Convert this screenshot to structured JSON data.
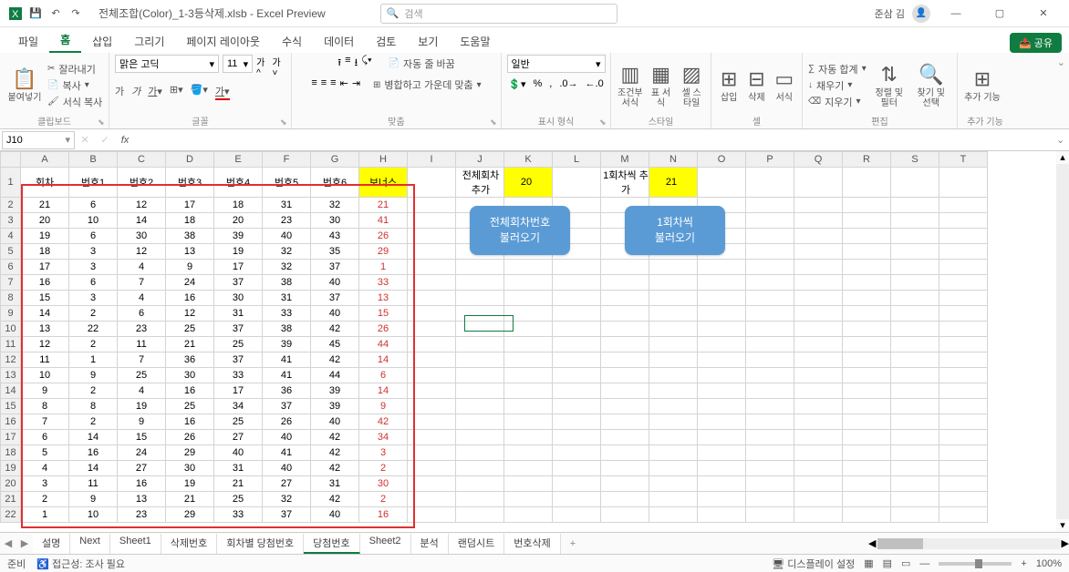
{
  "title": {
    "filename": "전체조합(Color)_1-3등삭제.xlsb - Excel Preview",
    "search_placeholder": "검색",
    "user": "준삼 김"
  },
  "menus": {
    "file": "파일",
    "home": "홈",
    "insert": "삽입",
    "draw": "그리기",
    "pagelayout": "페이지 레이아웃",
    "formulas": "수식",
    "data": "데이터",
    "review": "검토",
    "view": "보기",
    "help": "도움말",
    "share": "공유"
  },
  "ribbon": {
    "clipboard": {
      "label": "클립보드",
      "paste": "붙여넣기",
      "cut": "잘라내기",
      "copy": "복사",
      "format_painter": "서식 복사"
    },
    "font": {
      "label": "글꼴",
      "name": "맑은 고딕",
      "size": "11"
    },
    "align": {
      "label": "맞춤",
      "wrap": "자동 줄 바꿈",
      "merge": "병합하고 가운데 맞춤"
    },
    "number": {
      "label": "표시 형식",
      "format": "일반"
    },
    "styles": {
      "label": "스타일",
      "cond": "조건부\n서식",
      "table": "표\n서식",
      "cell": "셀\n스타일"
    },
    "cells": {
      "label": "셀",
      "insert": "삽입",
      "delete": "삭제",
      "format": "서식"
    },
    "editing": {
      "label": "편집",
      "sum": "자동 합계",
      "fill": "채우기",
      "clear": "지우기",
      "sort": "정렬 및\n필터",
      "find": "찾기 및\n선택"
    },
    "addins": {
      "label": "추가 기능",
      "btn": "추가\n기능"
    }
  },
  "namebox": "J10",
  "columns": [
    "A",
    "B",
    "C",
    "D",
    "E",
    "F",
    "G",
    "H",
    "I",
    "J",
    "K",
    "L",
    "M",
    "N",
    "O",
    "P",
    "Q",
    "R",
    "S",
    "T"
  ],
  "headers": {
    "A": "회차",
    "B": "번호1",
    "C": "번호2",
    "D": "번호3",
    "E": "번호4",
    "F": "번호5",
    "G": "번호6",
    "H": "보너스"
  },
  "side": {
    "J1": "전체회차 추가",
    "K1": "20",
    "M1": "1회차씩 추가",
    "N1": "21"
  },
  "buttons": {
    "all": "전체회차번호\n불러오기",
    "one": "1회차씩\n불러오기"
  },
  "rows": [
    [
      21,
      6,
      12,
      17,
      18,
      31,
      32,
      21
    ],
    [
      20,
      10,
      14,
      18,
      20,
      23,
      30,
      41
    ],
    [
      19,
      6,
      30,
      38,
      39,
      40,
      43,
      26
    ],
    [
      18,
      3,
      12,
      13,
      19,
      32,
      35,
      29
    ],
    [
      17,
      3,
      4,
      9,
      17,
      32,
      37,
      1
    ],
    [
      16,
      6,
      7,
      24,
      37,
      38,
      40,
      33
    ],
    [
      15,
      3,
      4,
      16,
      30,
      31,
      37,
      13
    ],
    [
      14,
      2,
      6,
      12,
      31,
      33,
      40,
      15
    ],
    [
      13,
      22,
      23,
      25,
      37,
      38,
      42,
      26
    ],
    [
      12,
      2,
      11,
      21,
      25,
      39,
      45,
      44
    ],
    [
      11,
      1,
      7,
      36,
      37,
      41,
      42,
      14
    ],
    [
      10,
      9,
      25,
      30,
      33,
      41,
      44,
      6
    ],
    [
      9,
      2,
      4,
      16,
      17,
      36,
      39,
      14
    ],
    [
      8,
      8,
      19,
      25,
      34,
      37,
      39,
      9
    ],
    [
      7,
      2,
      9,
      16,
      25,
      26,
      40,
      42
    ],
    [
      6,
      14,
      15,
      26,
      27,
      40,
      42,
      34
    ],
    [
      5,
      16,
      24,
      29,
      40,
      41,
      42,
      3
    ],
    [
      4,
      14,
      27,
      30,
      31,
      40,
      42,
      2
    ],
    [
      3,
      11,
      16,
      19,
      21,
      27,
      31,
      30
    ],
    [
      2,
      9,
      13,
      21,
      25,
      32,
      42,
      2
    ],
    [
      1,
      10,
      23,
      29,
      33,
      37,
      40,
      16
    ]
  ],
  "sheets": {
    "tabs": [
      "설명",
      "Next",
      "Sheet1",
      "삭제번호",
      "회차별 당첨번호",
      "당첨번호",
      "Sheet2",
      "분석",
      "랜덤시트",
      "번호삭제"
    ],
    "active": "당첨번호"
  },
  "status": {
    "ready": "준비",
    "access": "접근성: 조사 필요",
    "display": "디스플레이 설정",
    "zoom": "100%"
  }
}
